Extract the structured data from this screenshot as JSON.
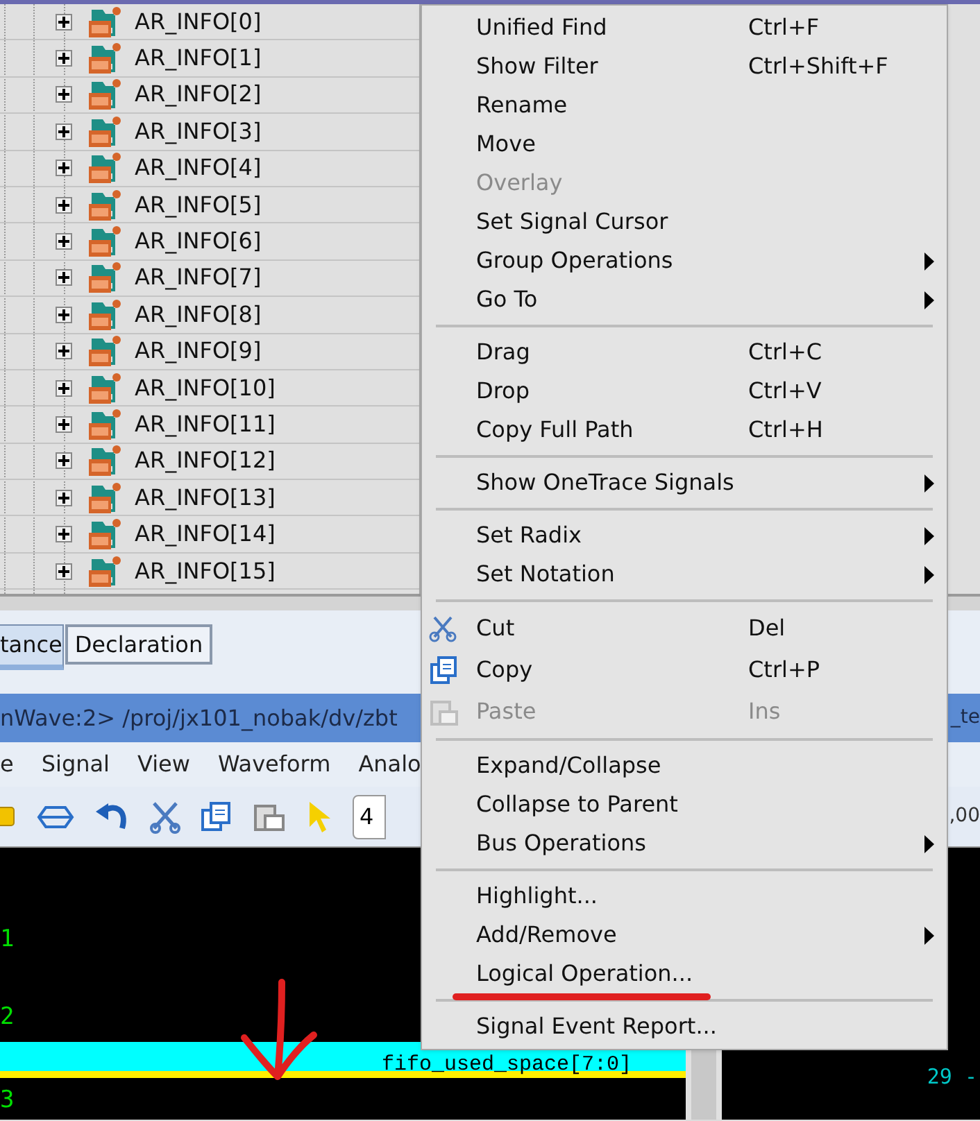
{
  "hierarchy": {
    "rows": [
      {
        "label": "AR_INFO[0]",
        "expanded": false
      },
      {
        "label": "AR_INFO[1]",
        "expanded": false
      },
      {
        "label": "AR_INFO[2]",
        "expanded": false
      },
      {
        "label": "AR_INFO[3]",
        "expanded": false
      },
      {
        "label": "AR_INFO[4]",
        "expanded": false
      },
      {
        "label": "AR_INFO[5]",
        "expanded": false
      },
      {
        "label": "AR_INFO[6]",
        "expanded": false
      },
      {
        "label": "AR_INFO[7]",
        "expanded": false
      },
      {
        "label": "AR_INFO[8]",
        "expanded": false
      },
      {
        "label": "AR_INFO[9]",
        "expanded": false
      },
      {
        "label": "AR_INFO[10]",
        "expanded": false
      },
      {
        "label": "AR_INFO[11]",
        "expanded": false
      },
      {
        "label": "AR_INFO[12]",
        "expanded": false
      },
      {
        "label": "AR_INFO[13]",
        "expanded": false
      },
      {
        "label": "AR_INFO[14]",
        "expanded": false
      },
      {
        "label": "AR_INFO[15]",
        "expanded": false
      }
    ]
  },
  "tabs": [
    {
      "label": "tance",
      "selected": true
    },
    {
      "label": "Declaration",
      "selected": false
    }
  ],
  "waveform_window": {
    "title": "nWave:2> /proj/jx101_nobak/dv/zbt",
    "title_right": "_te",
    "menu_bar": [
      "e",
      "Signal",
      "View",
      "Waveform",
      "Analo"
    ],
    "toolbar": {
      "field_value": "4",
      "right_value": ",00"
    },
    "signal_groups": [
      {
        "label": "1"
      },
      {
        "label": "2"
      },
      {
        "label": "3"
      }
    ],
    "selected_signal": {
      "name": "fifo_used_space[7:0]",
      "value": "29 -"
    }
  },
  "context_menu": [
    {
      "kind": "item",
      "label": "Unified Find",
      "shortcut": "Ctrl+F",
      "disabled": false,
      "submenu": false
    },
    {
      "kind": "item",
      "label": "Show Filter",
      "shortcut": "Ctrl+Shift+F",
      "disabled": false,
      "submenu": false
    },
    {
      "kind": "item",
      "label": "Rename",
      "disabled": false,
      "submenu": false
    },
    {
      "kind": "item",
      "label": "Move",
      "disabled": false,
      "submenu": false
    },
    {
      "kind": "item",
      "label": "Overlay",
      "disabled": true,
      "submenu": false
    },
    {
      "kind": "item",
      "label": "Set Signal Cursor",
      "disabled": false,
      "submenu": false
    },
    {
      "kind": "item",
      "label": "Group Operations",
      "disabled": false,
      "submenu": true
    },
    {
      "kind": "item",
      "label": "Go To",
      "disabled": false,
      "submenu": true
    },
    {
      "kind": "separator"
    },
    {
      "kind": "item",
      "label": "Drag",
      "shortcut": "Ctrl+C",
      "disabled": false,
      "submenu": false
    },
    {
      "kind": "item",
      "label": "Drop",
      "shortcut": "Ctrl+V",
      "disabled": false,
      "submenu": false
    },
    {
      "kind": "item",
      "label": "Copy Full Path",
      "shortcut": "Ctrl+H",
      "disabled": false,
      "submenu": false
    },
    {
      "kind": "separator"
    },
    {
      "kind": "item",
      "label": "Show OneTrace Signals",
      "disabled": false,
      "submenu": true
    },
    {
      "kind": "separator"
    },
    {
      "kind": "item",
      "label": "Set Radix",
      "disabled": false,
      "submenu": true
    },
    {
      "kind": "item",
      "label": "Set Notation",
      "disabled": false,
      "submenu": true
    },
    {
      "kind": "separator"
    },
    {
      "kind": "cut",
      "label": "Cut",
      "shortcut": "Del",
      "disabled": false,
      "submenu": false
    },
    {
      "kind": "copy",
      "label": "Copy",
      "shortcut": "Ctrl+P",
      "disabled": false,
      "submenu": false
    },
    {
      "kind": "paste",
      "label": "Paste",
      "shortcut": "Ins",
      "disabled": true,
      "submenu": false
    },
    {
      "kind": "separator"
    },
    {
      "kind": "item",
      "label": "Expand/Collapse",
      "disabled": false,
      "submenu": false
    },
    {
      "kind": "item",
      "label": "Collapse to Parent",
      "disabled": false,
      "submenu": false
    },
    {
      "kind": "item",
      "label": "Bus Operations",
      "disabled": false,
      "submenu": true
    },
    {
      "kind": "separator"
    },
    {
      "kind": "item",
      "label": "Highlight...",
      "disabled": false,
      "submenu": false
    },
    {
      "kind": "item",
      "label": "Add/Remove",
      "disabled": false,
      "submenu": true
    },
    {
      "kind": "item",
      "label": "Logical Operation...",
      "disabled": false,
      "submenu": false
    },
    {
      "kind": "separator"
    },
    {
      "kind": "item",
      "label": "Signal Event Report...",
      "disabled": false,
      "submenu": false
    }
  ]
}
